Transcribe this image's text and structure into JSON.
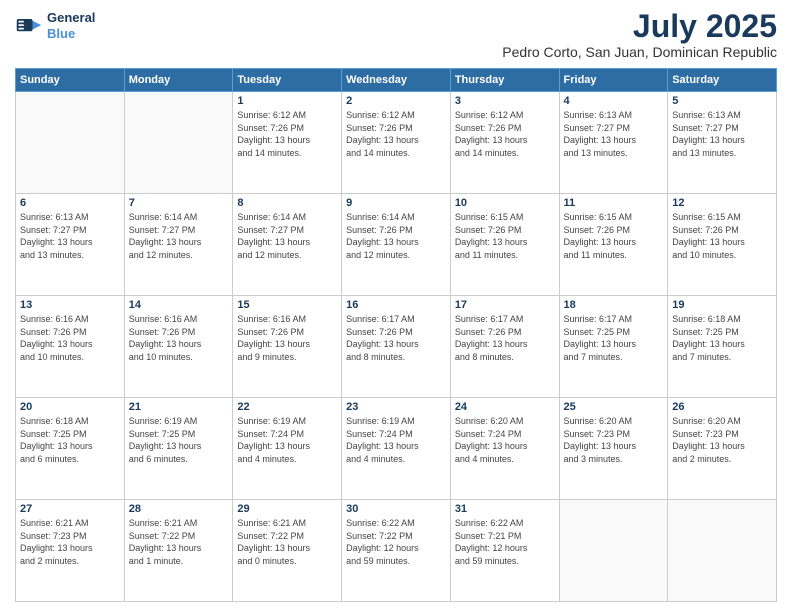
{
  "header": {
    "logo_line1": "General",
    "logo_line2": "Blue",
    "month": "July 2025",
    "location": "Pedro Corto, San Juan, Dominican Republic"
  },
  "days_of_week": [
    "Sunday",
    "Monday",
    "Tuesday",
    "Wednesday",
    "Thursday",
    "Friday",
    "Saturday"
  ],
  "weeks": [
    [
      {
        "day": "",
        "info": ""
      },
      {
        "day": "",
        "info": ""
      },
      {
        "day": "1",
        "info": "Sunrise: 6:12 AM\nSunset: 7:26 PM\nDaylight: 13 hours\nand 14 minutes."
      },
      {
        "day": "2",
        "info": "Sunrise: 6:12 AM\nSunset: 7:26 PM\nDaylight: 13 hours\nand 14 minutes."
      },
      {
        "day": "3",
        "info": "Sunrise: 6:12 AM\nSunset: 7:26 PM\nDaylight: 13 hours\nand 14 minutes."
      },
      {
        "day": "4",
        "info": "Sunrise: 6:13 AM\nSunset: 7:27 PM\nDaylight: 13 hours\nand 13 minutes."
      },
      {
        "day": "5",
        "info": "Sunrise: 6:13 AM\nSunset: 7:27 PM\nDaylight: 13 hours\nand 13 minutes."
      }
    ],
    [
      {
        "day": "6",
        "info": "Sunrise: 6:13 AM\nSunset: 7:27 PM\nDaylight: 13 hours\nand 13 minutes."
      },
      {
        "day": "7",
        "info": "Sunrise: 6:14 AM\nSunset: 7:27 PM\nDaylight: 13 hours\nand 12 minutes."
      },
      {
        "day": "8",
        "info": "Sunrise: 6:14 AM\nSunset: 7:27 PM\nDaylight: 13 hours\nand 12 minutes."
      },
      {
        "day": "9",
        "info": "Sunrise: 6:14 AM\nSunset: 7:26 PM\nDaylight: 13 hours\nand 12 minutes."
      },
      {
        "day": "10",
        "info": "Sunrise: 6:15 AM\nSunset: 7:26 PM\nDaylight: 13 hours\nand 11 minutes."
      },
      {
        "day": "11",
        "info": "Sunrise: 6:15 AM\nSunset: 7:26 PM\nDaylight: 13 hours\nand 11 minutes."
      },
      {
        "day": "12",
        "info": "Sunrise: 6:15 AM\nSunset: 7:26 PM\nDaylight: 13 hours\nand 10 minutes."
      }
    ],
    [
      {
        "day": "13",
        "info": "Sunrise: 6:16 AM\nSunset: 7:26 PM\nDaylight: 13 hours\nand 10 minutes."
      },
      {
        "day": "14",
        "info": "Sunrise: 6:16 AM\nSunset: 7:26 PM\nDaylight: 13 hours\nand 10 minutes."
      },
      {
        "day": "15",
        "info": "Sunrise: 6:16 AM\nSunset: 7:26 PM\nDaylight: 13 hours\nand 9 minutes."
      },
      {
        "day": "16",
        "info": "Sunrise: 6:17 AM\nSunset: 7:26 PM\nDaylight: 13 hours\nand 8 minutes."
      },
      {
        "day": "17",
        "info": "Sunrise: 6:17 AM\nSunset: 7:26 PM\nDaylight: 13 hours\nand 8 minutes."
      },
      {
        "day": "18",
        "info": "Sunrise: 6:17 AM\nSunset: 7:25 PM\nDaylight: 13 hours\nand 7 minutes."
      },
      {
        "day": "19",
        "info": "Sunrise: 6:18 AM\nSunset: 7:25 PM\nDaylight: 13 hours\nand 7 minutes."
      }
    ],
    [
      {
        "day": "20",
        "info": "Sunrise: 6:18 AM\nSunset: 7:25 PM\nDaylight: 13 hours\nand 6 minutes."
      },
      {
        "day": "21",
        "info": "Sunrise: 6:19 AM\nSunset: 7:25 PM\nDaylight: 13 hours\nand 6 minutes."
      },
      {
        "day": "22",
        "info": "Sunrise: 6:19 AM\nSunset: 7:24 PM\nDaylight: 13 hours\nand 4 minutes."
      },
      {
        "day": "23",
        "info": "Sunrise: 6:19 AM\nSunset: 7:24 PM\nDaylight: 13 hours\nand 4 minutes."
      },
      {
        "day": "24",
        "info": "Sunrise: 6:20 AM\nSunset: 7:24 PM\nDaylight: 13 hours\nand 4 minutes."
      },
      {
        "day": "25",
        "info": "Sunrise: 6:20 AM\nSunset: 7:23 PM\nDaylight: 13 hours\nand 3 minutes."
      },
      {
        "day": "26",
        "info": "Sunrise: 6:20 AM\nSunset: 7:23 PM\nDaylight: 13 hours\nand 2 minutes."
      }
    ],
    [
      {
        "day": "27",
        "info": "Sunrise: 6:21 AM\nSunset: 7:23 PM\nDaylight: 13 hours\nand 2 minutes."
      },
      {
        "day": "28",
        "info": "Sunrise: 6:21 AM\nSunset: 7:22 PM\nDaylight: 13 hours\nand 1 minute."
      },
      {
        "day": "29",
        "info": "Sunrise: 6:21 AM\nSunset: 7:22 PM\nDaylight: 13 hours\nand 0 minutes."
      },
      {
        "day": "30",
        "info": "Sunrise: 6:22 AM\nSunset: 7:22 PM\nDaylight: 12 hours\nand 59 minutes."
      },
      {
        "day": "31",
        "info": "Sunrise: 6:22 AM\nSunset: 7:21 PM\nDaylight: 12 hours\nand 59 minutes."
      },
      {
        "day": "",
        "info": ""
      },
      {
        "day": "",
        "info": ""
      }
    ]
  ]
}
